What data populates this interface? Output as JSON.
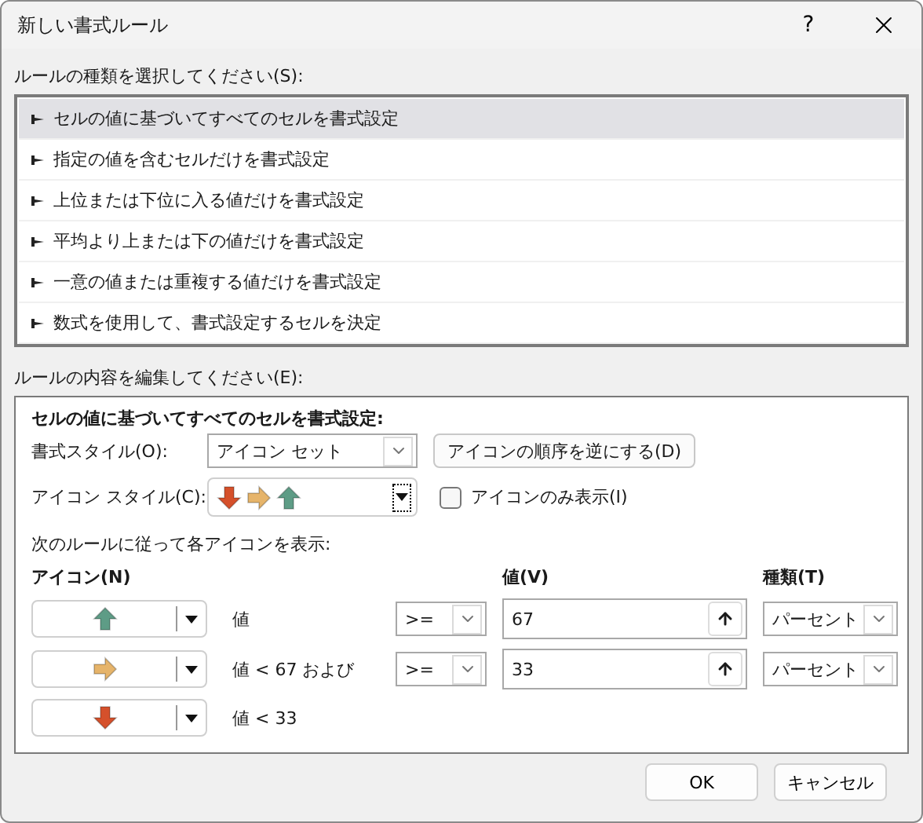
{
  "window": {
    "title": "新しい書式ルール",
    "help": "?"
  },
  "rule_type_label": "ルールの種類を選択してください(S):",
  "rule_types": [
    {
      "label": "セルの値に基づいてすべてのセルを書式設定",
      "selected": true
    },
    {
      "label": "指定の値を含むセルだけを書式設定",
      "selected": false
    },
    {
      "label": "上位または下位に入る値だけを書式設定",
      "selected": false
    },
    {
      "label": "平均より上または下の値だけを書式設定",
      "selected": false
    },
    {
      "label": "一意の値または重複する値だけを書式設定",
      "selected": false
    },
    {
      "label": "数式を使用して、書式設定するセルを決定",
      "selected": false
    }
  ],
  "edit_label": "ルールの内容を編集してください(E):",
  "editor": {
    "heading": "セルの値に基づいてすべてのセルを書式設定:",
    "format_style": {
      "label": "書式スタイル(O):",
      "value": "アイコン セット"
    },
    "reverse_button": "アイコンの順序を逆にする(D)",
    "icon_style": {
      "label": "アイコン スタイル(C):",
      "icons": [
        {
          "kind": "down",
          "color": "#d5502b"
        },
        {
          "kind": "right",
          "color": "#e6b46a"
        },
        {
          "kind": "up",
          "color": "#5e9c86"
        }
      ]
    },
    "icon_only": {
      "label": "アイコンのみ表示(I)",
      "checked": false
    },
    "rules_label": "次のルールに従って各アイコンを表示:",
    "columns": {
      "icon": "アイコン(N)",
      "value": "値(V)",
      "type": "種類(T)"
    },
    "rules": [
      {
        "icon": {
          "kind": "up",
          "color": "#5e9c86"
        },
        "condition": "値",
        "operator": ">=",
        "value": "67",
        "type": "パーセント"
      },
      {
        "icon": {
          "kind": "right",
          "color": "#e6b46a"
        },
        "condition": "値 < 67 および",
        "operator": ">=",
        "value": "33",
        "type": "パーセント"
      },
      {
        "icon": {
          "kind": "down",
          "color": "#d5502b"
        },
        "condition": "値 < 33"
      }
    ]
  },
  "buttons": [
    {
      "label": "OK"
    },
    {
      "label": "キャンセル"
    }
  ]
}
